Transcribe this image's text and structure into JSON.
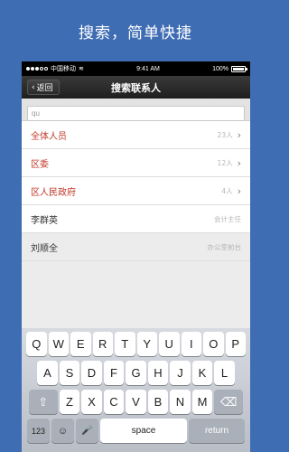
{
  "headline": "搜索，简单快捷",
  "status": {
    "carrier": "中国移动",
    "wifi": "≋",
    "time": "9:41 AM",
    "battery": "100%"
  },
  "nav": {
    "back_label": "返回",
    "back_icon": "‹",
    "title": "搜索联系人"
  },
  "search": {
    "value": "qu"
  },
  "results": [
    {
      "name": "全体人员",
      "meta": "23人",
      "chevron": "›",
      "red": true
    },
    {
      "name": "区委",
      "meta": "12人",
      "chevron": "›",
      "red": true
    },
    {
      "name": "区人民政府",
      "meta": "4人",
      "chevron": "›",
      "red": true
    },
    {
      "name": "李群英",
      "meta": "会计主任",
      "chevron": "",
      "red": false
    },
    {
      "name": "刘顺全",
      "meta": "办公室前台",
      "chevron": "",
      "red": false
    }
  ],
  "keyboard": {
    "row1": [
      "Q",
      "W",
      "E",
      "R",
      "T",
      "Y",
      "U",
      "I",
      "O",
      "P"
    ],
    "row2": [
      "A",
      "S",
      "D",
      "F",
      "G",
      "H",
      "J",
      "K",
      "L"
    ],
    "row3": [
      "Z",
      "X",
      "C",
      "V",
      "B",
      "N",
      "M"
    ],
    "shift": "⇧",
    "delete": "⌫",
    "numbers": "123",
    "emoji": "☺",
    "mic": "🎤",
    "space": "space",
    "return": "return"
  }
}
